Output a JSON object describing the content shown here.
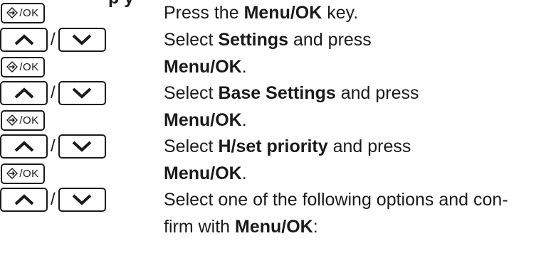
{
  "section_title_fragment": "p        y",
  "key_labels": {
    "menu_ok": "/OK",
    "slash": "/"
  },
  "icons": {
    "menu": "menu-diamond-arrow-icon",
    "up": "arrow-up-icon",
    "down": "arrow-down-icon"
  },
  "steps": [
    {
      "text_before": "Press the ",
      "bold": "Menu/OK",
      "text_after": " key."
    },
    {
      "text_before": "Select ",
      "bold": "Settings",
      "text_after": " and press"
    },
    {
      "text_before": "",
      "bold": "Menu/OK",
      "text_after": "."
    },
    {
      "text_before": "Select ",
      "bold": "Base Settings",
      "text_after": " and press"
    },
    {
      "text_before": "",
      "bold": "Menu/OK",
      "text_after": "."
    },
    {
      "text_before": "Select ",
      "bold": "H/set priority",
      "text_after": " and press"
    },
    {
      "text_before": "",
      "bold": "Menu/OK",
      "text_after": "."
    },
    {
      "text_before": "Select one of the following options and con-",
      "bold": "",
      "text_after": ""
    },
    {
      "text_before": "firm with ",
      "bold": "Menu/OK",
      "text_after": ":"
    }
  ]
}
